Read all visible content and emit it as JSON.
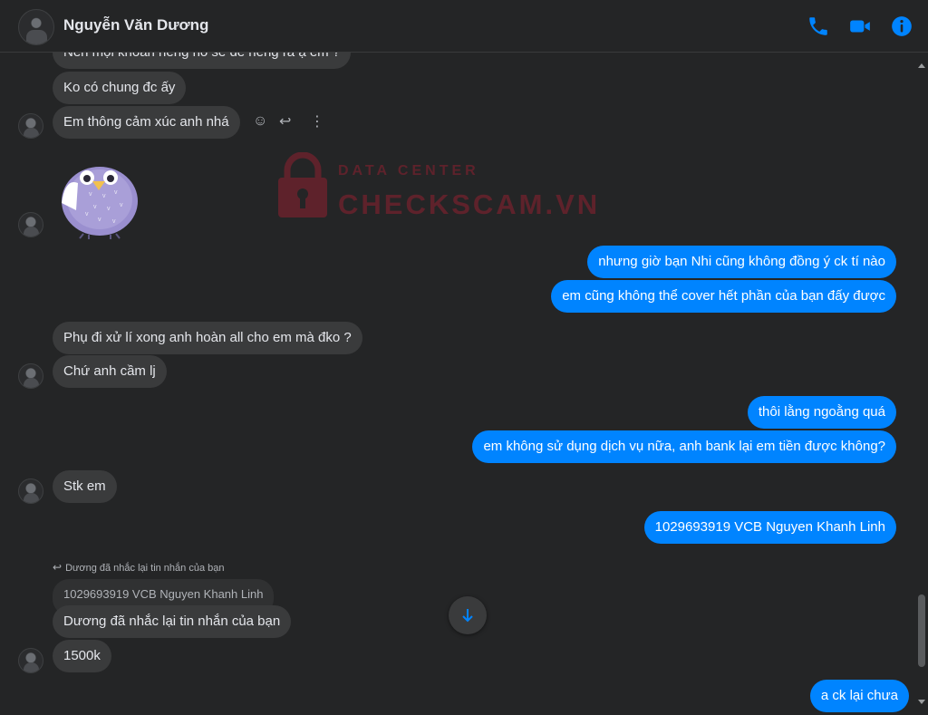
{
  "header": {
    "name": "Nguyễn Văn Dương",
    "icons": [
      "phone-icon",
      "video-call-icon",
      "info-icon"
    ],
    "accent": "#0084ff"
  },
  "messages": {
    "m0": "Nên mọi khoản riêng nó sẽ để riêng ra ạ em ?",
    "m1": "Ko có chung đc ấy",
    "m2": "Em thông cảm xúc anh nhá",
    "m3": "nhưng giờ bạn Nhi cũng không đồng ý ck tí nào",
    "m4": "em cũng không thể cover hết phần của bạn đấy được",
    "m5": "Phụ đi xử lí xong anh hoàn all cho em mà đko ?",
    "m6": "Chứ anh cầm lj",
    "m7": "thôi lằng ngoằng quá",
    "m8": "em không sử dụng dịch vụ nữa, anh bank lại em tiền được không?",
    "m9": "Stk em",
    "m10": "1029693919 VCB Nguyen Khanh Linh",
    "reply_note": "Dương đã nhắc lại tin nhắn của bạn",
    "quoted": "1029693919 VCB Nguyen Khanh Linh",
    "m11": "Dương đã nhắc lại tin nhắn của bạn",
    "m12": "1500k",
    "m13": "a ck lại chưa"
  },
  "watermark": {
    "top": "DATA CENTER",
    "main": "CHECKSCAM.VN"
  },
  "colors": {
    "background": "#242526",
    "incoming": "#3a3b3c",
    "outgoing": "#0084ff",
    "watermark": "#8f2030"
  }
}
